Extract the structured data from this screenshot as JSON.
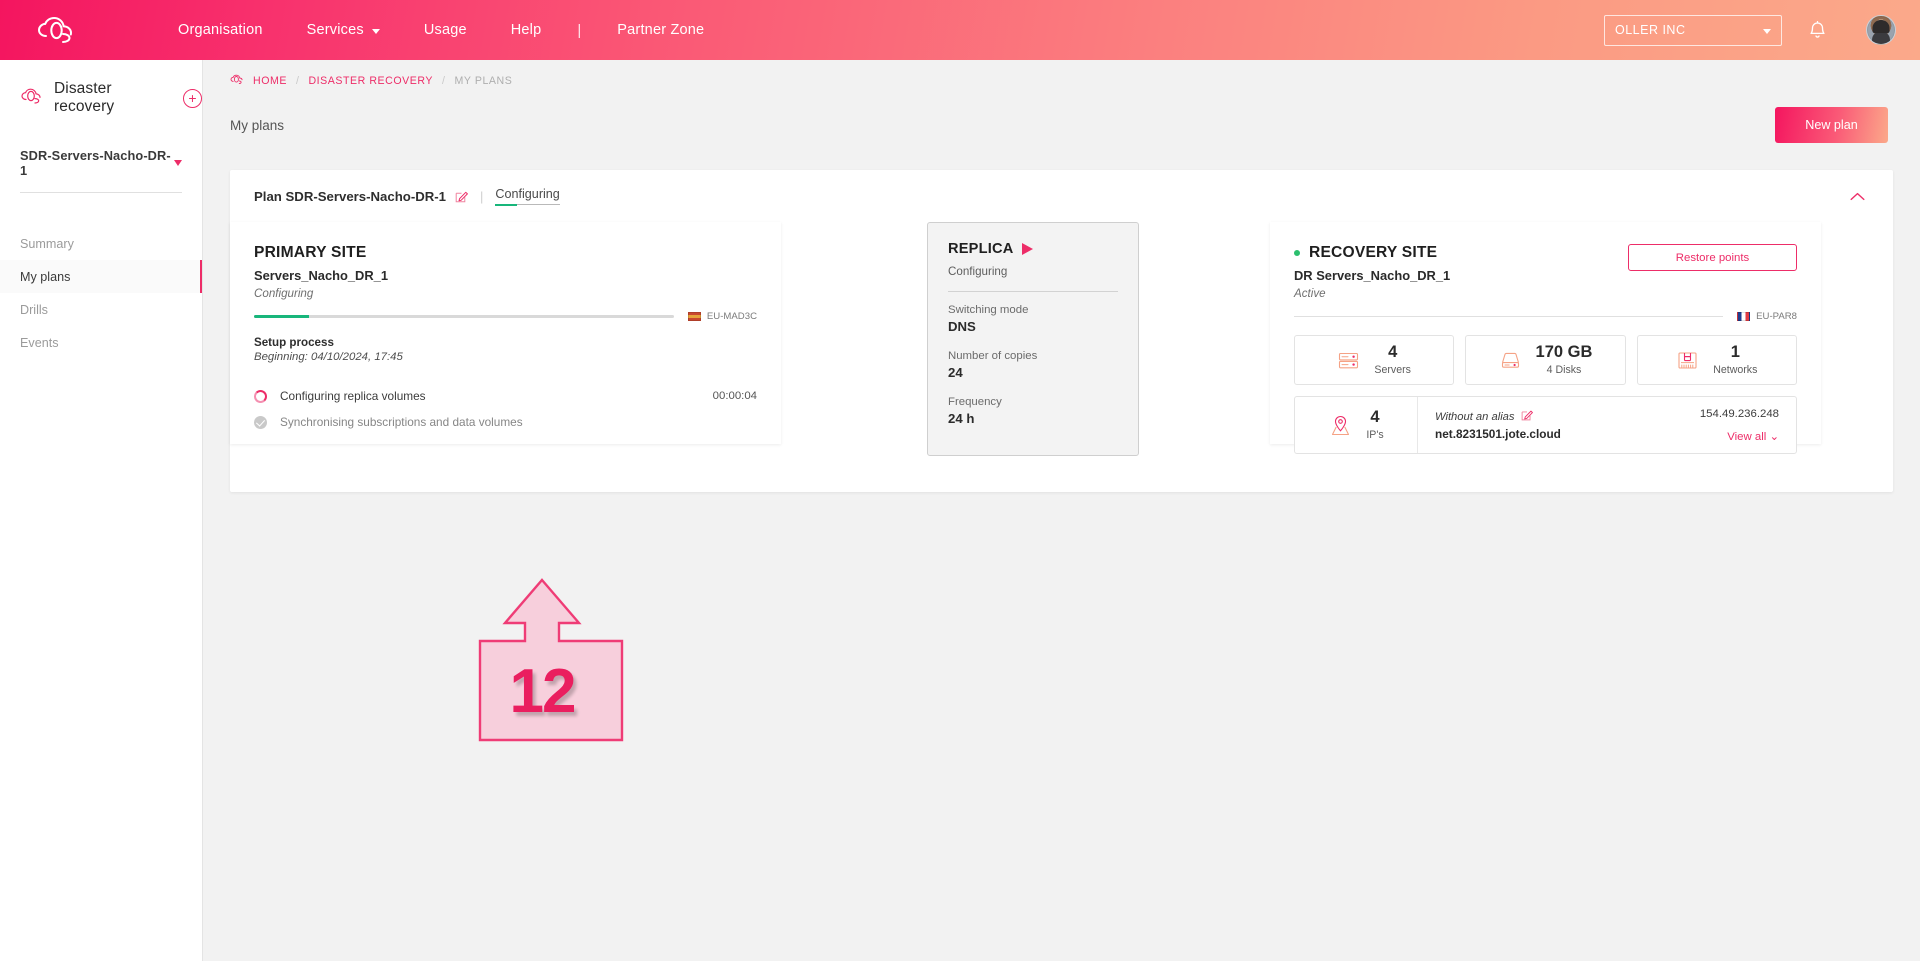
{
  "theme": {
    "accent_pink": "#ed2d68",
    "accent_salmon": "#fba98a",
    "success_green": "#18b67b",
    "page_bg": "#f2f2f2"
  },
  "topbar": {
    "logo_name": "cloud-logo-icon",
    "nav": [
      {
        "label": "Organisation",
        "has_caret": false
      },
      {
        "label": "Services",
        "has_caret": true
      },
      {
        "label": "Usage",
        "has_caret": false
      },
      {
        "label": "Help",
        "has_caret": false
      }
    ],
    "separator": "|",
    "partner_zone": "Partner Zone",
    "org_selector": "OLLER INC",
    "bell_icon": "notification-bell-icon",
    "avatar_icon": "user-avatar"
  },
  "sidebar": {
    "service_title": "Disaster recovery",
    "add_button": "+",
    "plan_selector": "SDR-Servers-Nacho-DR-1",
    "items": [
      {
        "label": "Summary",
        "active": false
      },
      {
        "label": "My plans",
        "active": true
      },
      {
        "label": "Drills",
        "active": false
      },
      {
        "label": "Events",
        "active": false
      }
    ]
  },
  "breadcrumb": {
    "home_icon": "home-cloud-icon",
    "items": [
      "HOME",
      "DISASTER RECOVERY",
      "MY PLANS"
    ],
    "separator": "/"
  },
  "page": {
    "title": "My plans",
    "new_plan_label": "New plan"
  },
  "plan_header": {
    "name": "Plan SDR-Servers-Nacho-DR-1",
    "edit_icon": "edit-pencil-icon",
    "separator": "|",
    "status_link": "Configuring",
    "collapse_icon": "chevron-up-icon"
  },
  "primary_site": {
    "title": "PRIMARY SITE",
    "name": "Servers_Nacho_DR_1",
    "state": "Configuring",
    "progress_percent": 13,
    "region": {
      "label": "EU-MAD3C",
      "flag": "flag-spain-icon"
    },
    "setup_label": "Setup process",
    "setup_beginning": "Beginning: 04/10/2024, 17:45",
    "tasks": [
      {
        "label": "Configuring replica volumes",
        "status": "running",
        "time": "00:00:04",
        "icon": "spinner-icon"
      },
      {
        "label": "Synchronising subscriptions and data volumes",
        "status": "done",
        "time": "",
        "icon": "check-circle-icon"
      }
    ]
  },
  "replica": {
    "title": "REPLICA",
    "play_icon": "play-triangle-icon",
    "state": "Configuring",
    "fields": [
      {
        "label": "Switching mode",
        "value": "DNS"
      },
      {
        "label": "Number of copies",
        "value": "24"
      },
      {
        "label": "Frequency",
        "value": "24 h"
      }
    ]
  },
  "recovery_site": {
    "status_dot": "status-dot-active",
    "title": "RECOVERY SITE",
    "name": "DR Servers_Nacho_DR_1",
    "state": "Active",
    "restore_points_label": "Restore points",
    "region": {
      "label": "EU-PAR8",
      "flag": "flag-france-icon"
    },
    "stats": [
      {
        "value": "4",
        "caption": "Servers",
        "icon": "server-rack-icon"
      },
      {
        "value": "170 GB",
        "caption": "4 Disks",
        "icon": "disk-icon"
      },
      {
        "value": "1",
        "caption": "Networks",
        "icon": "network-icon"
      }
    ],
    "ip_block": {
      "count": "4",
      "count_caption": "IP's",
      "icon": "map-pin-icon",
      "alias": "Without an alias",
      "alias_edit_icon": "edit-pencil-icon",
      "host": "net.8231501.jote.cloud",
      "address": "154.49.236.248",
      "view_all": "View all"
    }
  },
  "annotation": {
    "number": "12",
    "shape": "up-arrow-callout"
  }
}
